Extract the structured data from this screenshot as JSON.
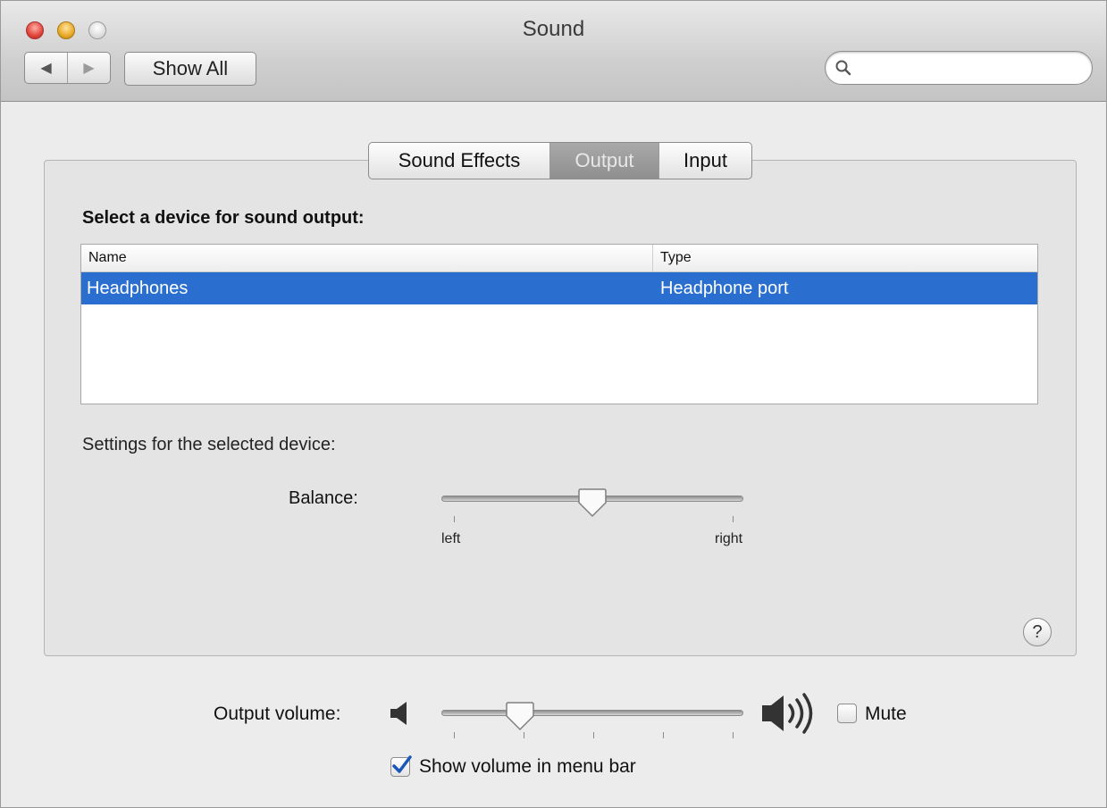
{
  "window": {
    "title": "Sound"
  },
  "toolbar": {
    "back_glyph": "◀",
    "forward_glyph": "▶",
    "show_all_label": "Show All",
    "search": {
      "value": "",
      "placeholder": ""
    }
  },
  "tabs": [
    {
      "label": "Sound Effects",
      "selected": false
    },
    {
      "label": "Output",
      "selected": true
    },
    {
      "label": "Input",
      "selected": false
    }
  ],
  "output": {
    "heading": "Select a device for sound output:",
    "table": {
      "columns": [
        "Name",
        "Type"
      ],
      "rows": [
        {
          "name": "Headphones",
          "type": "Headphone port",
          "selected": true
        }
      ]
    },
    "settings_label": "Settings for the selected device:",
    "balance": {
      "label": "Balance:",
      "left_label": "left",
      "right_label": "right",
      "value": 0.5
    },
    "help_label": "?"
  },
  "volume": {
    "label": "Output volume:",
    "value": 0.24,
    "mute_label": "Mute",
    "mute_checked": false,
    "show_in_menu_bar_label": "Show volume in menu bar",
    "show_in_menu_bar_checked": true
  },
  "colors": {
    "selection": "#2a6fd0",
    "window_bg": "#ececec"
  }
}
